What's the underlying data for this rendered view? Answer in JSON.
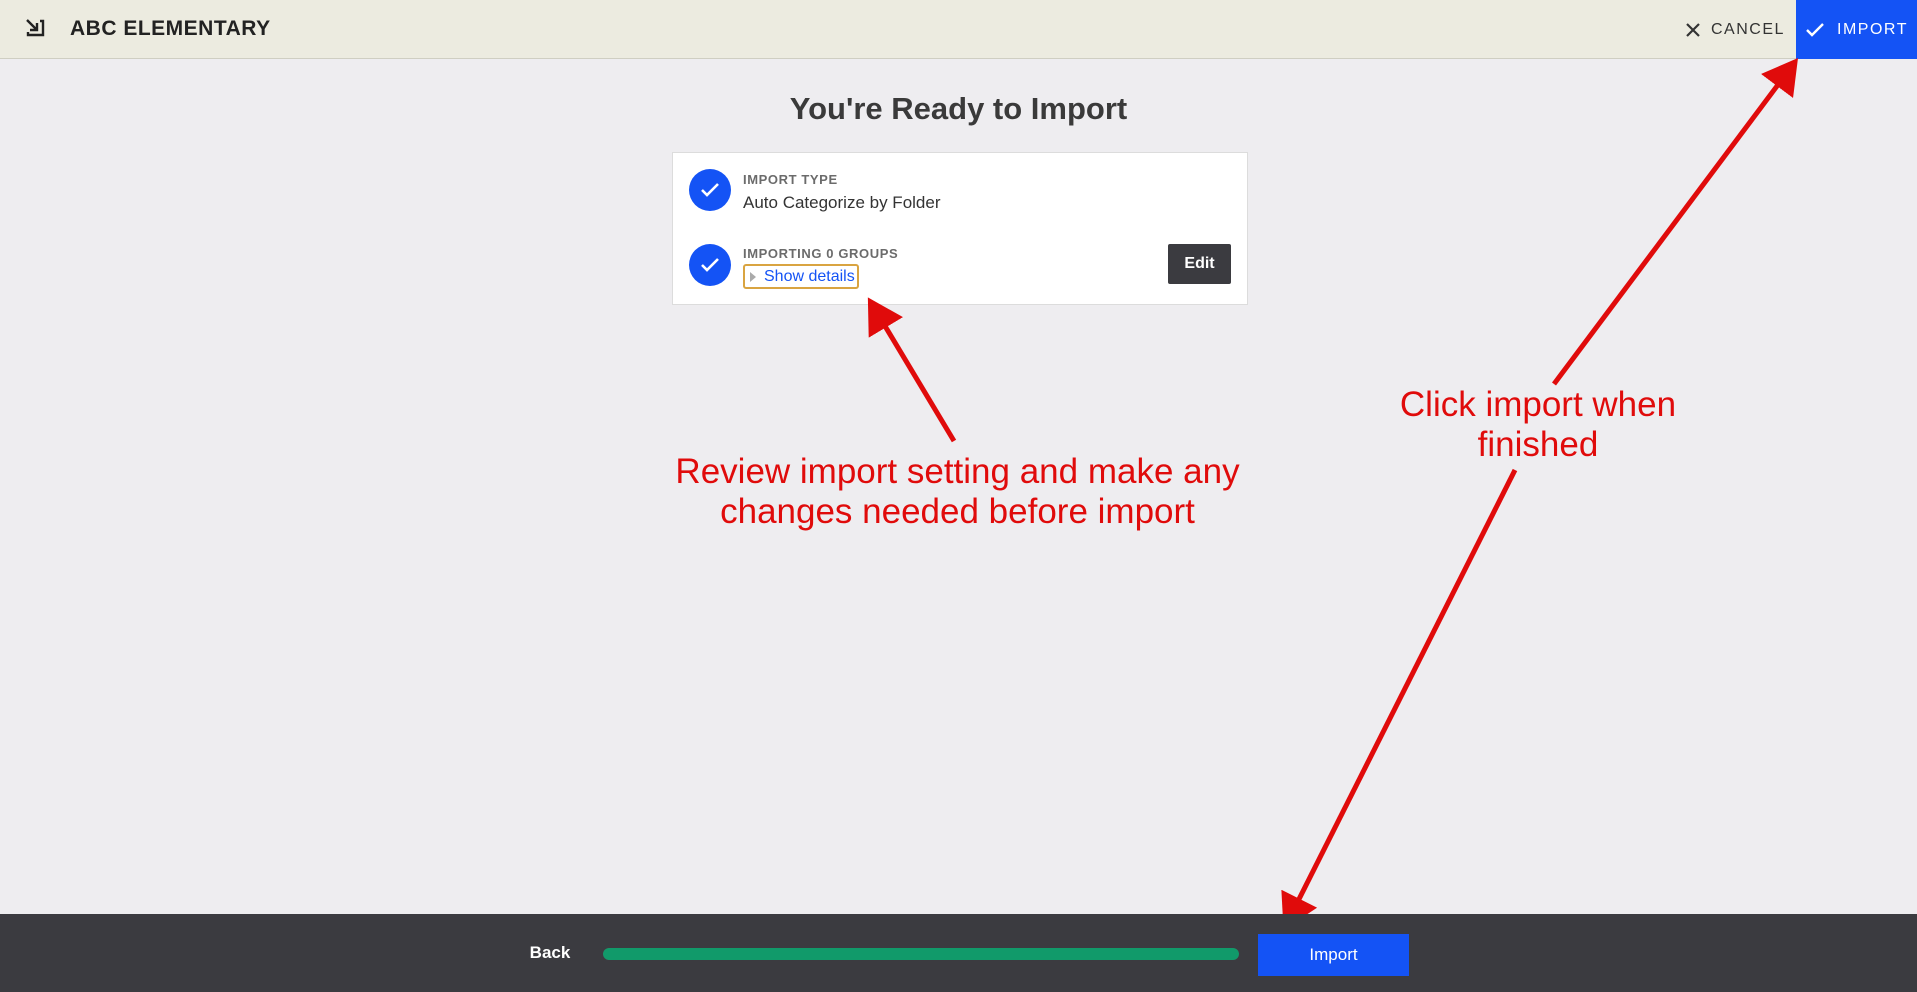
{
  "header": {
    "title": "ABC ELEMENTARY",
    "app_icon": "import-arrow-icon",
    "cancel_label": "CANCEL",
    "import_label": "IMPORT"
  },
  "main": {
    "title": "You're Ready to Import",
    "card": {
      "import_type_label": "IMPORT TYPE",
      "import_type_value": "Auto Categorize by Folder",
      "groups_label": "IMPORTING 0 GROUPS",
      "show_details_label": "Show details",
      "edit_label": "Edit"
    }
  },
  "footer": {
    "back_label": "Back",
    "progress_fraction": 1.0,
    "import_label": "Import"
  },
  "annotations": {
    "review_line1": "Review import setting and make any",
    "review_line2": "changes needed before import",
    "click_line1": "Click import when",
    "click_line2": "finished"
  },
  "colors": {
    "accent": "#1453f5",
    "progress": "#119a6a",
    "annotation": "#e00b0b",
    "footer_bg": "#3b3b40"
  }
}
